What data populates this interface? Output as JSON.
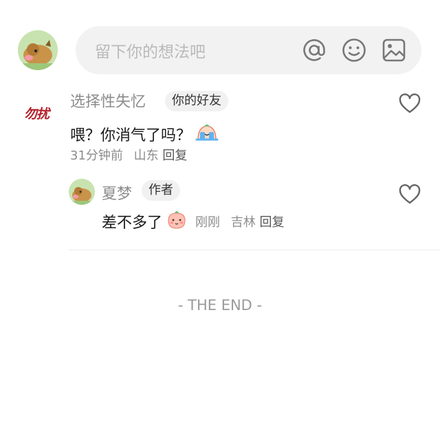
{
  "composer": {
    "placeholder": "留下你的想法吧",
    "icons": [
      "at-icon",
      "emoji-icon",
      "image-icon"
    ]
  },
  "comments": [
    {
      "author": "选择性失忆",
      "avatar_text": "勿扰",
      "tag": "你的好友",
      "text": "喂？你消气了吗？",
      "emoji": "crying-emoji",
      "time": "31分钟前",
      "location": "山东",
      "reply_label": "回复",
      "replies": [
        {
          "author": "夏梦",
          "tag": "作者",
          "text": "差不多了",
          "emoji": "blushing-emoji",
          "time": "刚刚",
          "location": "吉林",
          "reply_label": "回复"
        }
      ]
    }
  ],
  "footer": {
    "end_text": "- THE END -"
  },
  "colors": {
    "pill_bg": "#f2f2f2",
    "muted_text": "#8c8c8c",
    "avatar_text_red": "#b3202a"
  }
}
